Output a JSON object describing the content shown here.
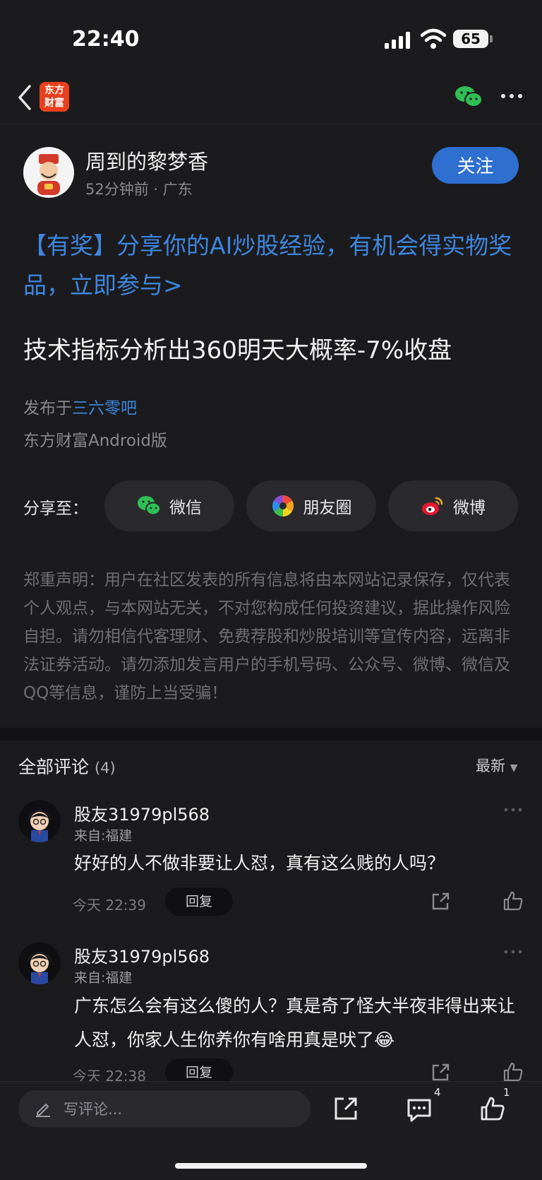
{
  "status_bar": {
    "time": "22:40",
    "battery": "65"
  },
  "nav": {
    "logo_line1": "东方",
    "logo_line2": "财富"
  },
  "author": {
    "name": "周到的黎梦香",
    "time_ago": "52分钟前",
    "location": "广东",
    "follow_label": "关注"
  },
  "post": {
    "promo": "【有奖】分享你的AI炒股经验，有机会得实物奖品，立即参与>",
    "title": "技术指标分析出360明天大概率-7%收盘",
    "published_prefix": "发布于",
    "bar_name": "三六零吧",
    "client": "东方财富Android版"
  },
  "share": {
    "label": "分享至：",
    "options": [
      {
        "label": "微信",
        "icon": "wechat-icon"
      },
      {
        "label": "朋友圈",
        "icon": "moments-icon"
      },
      {
        "label": "微博",
        "icon": "weibo-icon"
      }
    ]
  },
  "disclaimer": "郑重声明：用户在社区发表的所有信息将由本网站记录保存，仅代表个人观点，与本网站无关，不对您构成任何投资建议，据此操作风险自担。请勿相信代客理财、免费荐股和炒股培训等宣传内容，远离非法证券活动。请勿添加发言用户的手机号码、公众号、微博、微信及QQ等信息，谨防上当受骗！",
  "comments_header": {
    "title": "全部评论",
    "count": "(4)",
    "sort": "最新"
  },
  "comments": [
    {
      "user": "股友31979pl568",
      "location": "来自:福建",
      "text": "好好的人不做非要让人怼，真有这么贱的人吗？",
      "time": "今天 22:39",
      "reply_label": "回复"
    },
    {
      "user": "股友31979pl568",
      "location": "来自:福建",
      "text": "广东怎么会有这么傻的人？真是奇了怪大半夜非得出来让人怼，你家人生你养你有啥用真是吠了😂",
      "time": "今天 22:38",
      "reply_label": "回复"
    }
  ],
  "bottom_bar": {
    "placeholder": "写评论...",
    "comment_count": "4",
    "like_count": "1"
  }
}
